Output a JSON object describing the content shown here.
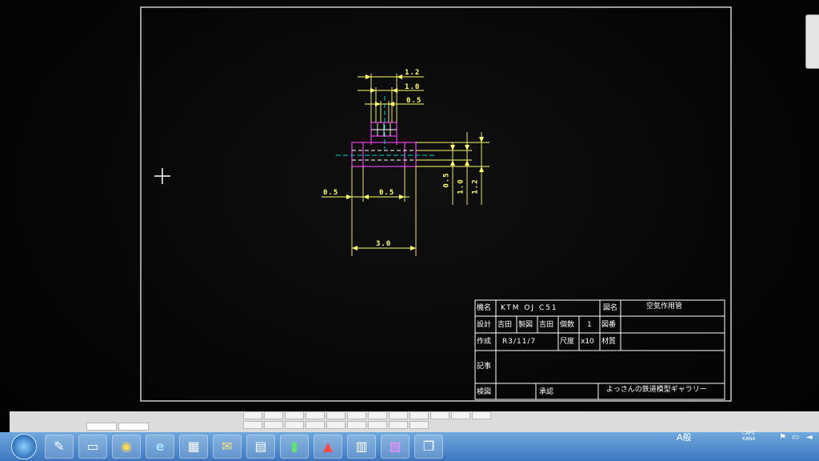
{
  "colors": {
    "frame": "#ffffff",
    "dimension": "#ffff66",
    "outline": "#ff44ff",
    "centerline": "#00cccc",
    "background": "#000000"
  },
  "dimensions": {
    "d_1_2_top": "1.2",
    "d_1_0_top": "1.0",
    "d_0_5_top": "0.5",
    "d_0_5_left": "0.5",
    "d_0_5_mid": "0.5",
    "d_3_0": "3.0",
    "d_0_5_v": "0.5",
    "d_1_0_v": "1.0",
    "d_1_2_v": "1.2"
  },
  "title_block": {
    "model_label": "機名",
    "model_value": "KTM OJ C51",
    "drawing_name_label": "図名",
    "drawing_name_value": "空気作用管",
    "design_label": "設計",
    "design_value": "吉田",
    "drafting_label": "製図",
    "drafting_value": "吉田",
    "quantity_label": "個数",
    "quantity_value": "1",
    "drawing_no_label": "図番",
    "created_label": "作成",
    "created_value": "R3/11/7",
    "scale_label": "尺度",
    "scale_value": "x10",
    "material_label": "材質",
    "notes_label": "記事",
    "check_label": "検図",
    "approve_label": "承認",
    "gallery_value": "よっさんの鉄道模型ギャラリー"
  },
  "taskbar": {
    "start_icon": "windows-start-icon",
    "apps": [
      "paint-icon",
      "file-icon",
      "chrome-icon",
      "ie-icon",
      "network-icon",
      "mail-icon",
      "notepad-icon",
      "green-app-icon",
      "pdf-icon",
      "calc-icon",
      "jw-cad-icon",
      "window-icon"
    ],
    "ime": "A般",
    "ime_mode": "CAPS KANA"
  }
}
